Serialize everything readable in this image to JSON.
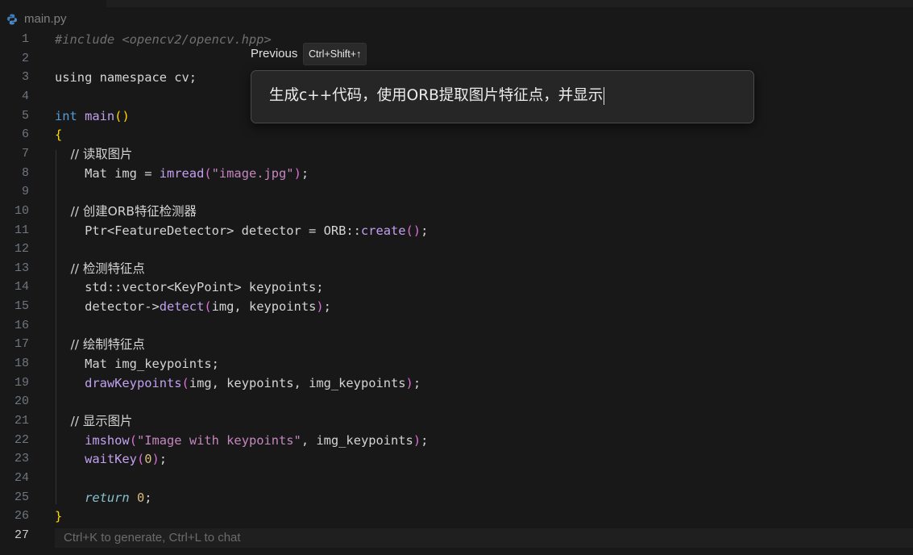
{
  "tab": {
    "title": "main.py",
    "icon": "python-file-icon"
  },
  "editor": {
    "current_line": "27",
    "lines": [
      {
        "n": "1",
        "tokens": [
          {
            "t": "#include <opencv2/opencv.hpp>",
            "c": "include"
          }
        ]
      },
      {
        "n": "2",
        "tokens": []
      },
      {
        "n": "3",
        "tokens": [
          {
            "t": "using namespace cv;",
            "c": "plain"
          }
        ]
      },
      {
        "n": "4",
        "tokens": []
      },
      {
        "n": "5",
        "tokens": [
          {
            "t": "int",
            "c": "keyword"
          },
          {
            "t": " ",
            "c": "plain"
          },
          {
            "t": "main",
            "c": "func"
          },
          {
            "t": "()",
            "c": "paren"
          }
        ]
      },
      {
        "n": "6",
        "tokens": [
          {
            "t": "{",
            "c": "paren"
          }
        ]
      },
      {
        "n": "7",
        "tokens": [
          {
            "t": "    // 读取图片",
            "c": "comment"
          }
        ]
      },
      {
        "n": "8",
        "tokens": [
          {
            "t": "    Mat img = ",
            "c": "plain"
          },
          {
            "t": "imread",
            "c": "func"
          },
          {
            "t": "(",
            "c": "paren2"
          },
          {
            "t": "\"image.jpg\"",
            "c": "string"
          },
          {
            "t": ")",
            "c": "paren2"
          },
          {
            "t": ";",
            "c": "plain"
          }
        ]
      },
      {
        "n": "9",
        "tokens": []
      },
      {
        "n": "10",
        "tokens": [
          {
            "t": "    // 创建ORB特征检测器",
            "c": "comment"
          }
        ]
      },
      {
        "n": "11",
        "tokens": [
          {
            "t": "    Ptr<FeatureDetector> detector = ORB::",
            "c": "plain"
          },
          {
            "t": "create",
            "c": "func"
          },
          {
            "t": "()",
            "c": "paren2"
          },
          {
            "t": ";",
            "c": "plain"
          }
        ]
      },
      {
        "n": "12",
        "tokens": []
      },
      {
        "n": "13",
        "tokens": [
          {
            "t": "    // 检测特征点",
            "c": "comment"
          }
        ]
      },
      {
        "n": "14",
        "tokens": [
          {
            "t": "    std::vector<KeyPoint> keypoints;",
            "c": "plain"
          }
        ]
      },
      {
        "n": "15",
        "tokens": [
          {
            "t": "    detector->",
            "c": "plain"
          },
          {
            "t": "detect",
            "c": "func"
          },
          {
            "t": "(",
            "c": "paren2"
          },
          {
            "t": "img, keypoints",
            "c": "plain"
          },
          {
            "t": ")",
            "c": "paren2"
          },
          {
            "t": ";",
            "c": "plain"
          }
        ]
      },
      {
        "n": "16",
        "tokens": []
      },
      {
        "n": "17",
        "tokens": [
          {
            "t": "    // 绘制特征点",
            "c": "comment"
          }
        ]
      },
      {
        "n": "18",
        "tokens": [
          {
            "t": "    Mat img_keypoints;",
            "c": "plain"
          }
        ]
      },
      {
        "n": "19",
        "tokens": [
          {
            "t": "    ",
            "c": "plain"
          },
          {
            "t": "drawKeypoints",
            "c": "func"
          },
          {
            "t": "(",
            "c": "paren2"
          },
          {
            "t": "img, keypoints, img_keypoints",
            "c": "plain"
          },
          {
            "t": ")",
            "c": "paren2"
          },
          {
            "t": ";",
            "c": "plain"
          }
        ]
      },
      {
        "n": "20",
        "tokens": []
      },
      {
        "n": "21",
        "tokens": [
          {
            "t": "    // 显示图片",
            "c": "comment"
          }
        ]
      },
      {
        "n": "22",
        "tokens": [
          {
            "t": "    ",
            "c": "plain"
          },
          {
            "t": "imshow",
            "c": "func"
          },
          {
            "t": "(",
            "c": "paren2"
          },
          {
            "t": "\"Image with keypoints\"",
            "c": "string"
          },
          {
            "t": ", img_keypoints",
            "c": "plain"
          },
          {
            "t": ")",
            "c": "paren2"
          },
          {
            "t": ";",
            "c": "plain"
          }
        ]
      },
      {
        "n": "23",
        "tokens": [
          {
            "t": "    ",
            "c": "plain"
          },
          {
            "t": "waitKey",
            "c": "func"
          },
          {
            "t": "(",
            "c": "paren2"
          },
          {
            "t": "0",
            "c": "number"
          },
          {
            "t": ")",
            "c": "paren2"
          },
          {
            "t": ";",
            "c": "plain"
          }
        ]
      },
      {
        "n": "24",
        "tokens": []
      },
      {
        "n": "25",
        "tokens": [
          {
            "t": "    ",
            "c": "plain"
          },
          {
            "t": "return",
            "c": "return"
          },
          {
            "t": " ",
            "c": "plain"
          },
          {
            "t": "0",
            "c": "number"
          },
          {
            "t": ";",
            "c": "plain"
          }
        ]
      },
      {
        "n": "26",
        "tokens": [
          {
            "t": "}",
            "c": "paren"
          }
        ]
      },
      {
        "n": "27",
        "tokens": []
      }
    ],
    "inline_hint": "Ctrl+K to generate, Ctrl+L to chat"
  },
  "generate_popup": {
    "previous_label": "Previous",
    "shortcut": "Ctrl+Shift+↑",
    "prompt_text": "生成c++代码，使用ORB提取图片特征点，并显示"
  }
}
